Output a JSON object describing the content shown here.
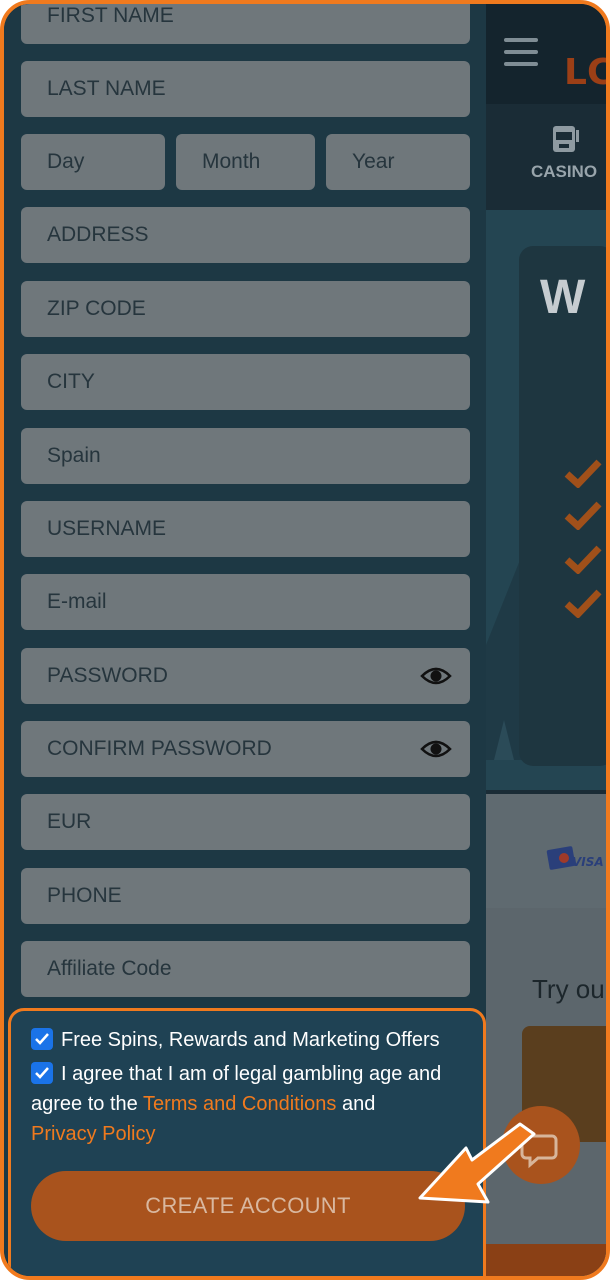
{
  "site": {
    "logo_text": "LC",
    "nav_tab": "CASINO",
    "hero_letter": "W",
    "payment_label": "VISA",
    "games_title": "Try ou"
  },
  "form": {
    "first_name_placeholder": "FIRST NAME",
    "last_name_placeholder": "LAST NAME",
    "day_placeholder": "Day",
    "month_placeholder": "Month",
    "year_placeholder": "Year",
    "address_placeholder": "ADDRESS",
    "zip_placeholder": "ZIP CODE",
    "city_placeholder": "CITY",
    "country_value": "Spain",
    "username_placeholder": "USERNAME",
    "email_placeholder": "E-mail",
    "password_placeholder": "PASSWORD",
    "confirm_password_placeholder": "CONFIRM PASSWORD",
    "currency_value": "EUR",
    "phone_placeholder": "PHONE",
    "affiliate_placeholder": "Affiliate Code"
  },
  "consent": {
    "offers_label": "Free Spins, Rewards and Marketing Offers",
    "offers_checked": true,
    "age_text_1": "I agree that I am of legal gambling age and agree to the ",
    "terms_link": "Terms and Conditions",
    "age_text_2": " and",
    "privacy_link": "Privacy Policy",
    "age_checked": true,
    "create_button": "CREATE ACCOUNT"
  },
  "colors": {
    "accent": "#f07a1e",
    "button": "#a9531d",
    "checkbox": "#1a73e8",
    "field": "#6f777b",
    "panel": "#1d3844"
  },
  "icons": [
    "menu-icon",
    "slot-machine-icon",
    "eye-icon",
    "checkmark-icon",
    "chat-icon",
    "pointer-arrow-icon"
  ]
}
